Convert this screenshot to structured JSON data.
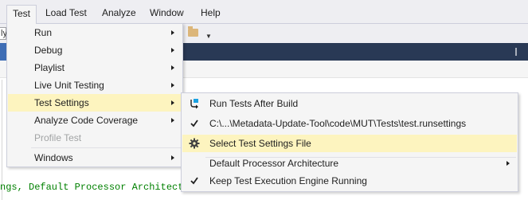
{
  "menubar": {
    "items": [
      {
        "label": "Test"
      },
      {
        "label": "Load Test"
      },
      {
        "label": "Analyze"
      },
      {
        "label": "Window"
      },
      {
        "label": "Help"
      }
    ]
  },
  "toolbar": {
    "field_text": "ly"
  },
  "code": {
    "line": "ngs, Default Processor Architect"
  },
  "test_menu": {
    "items": [
      {
        "label": "Run",
        "submenu": true
      },
      {
        "label": "Debug",
        "submenu": true
      },
      {
        "label": "Playlist",
        "submenu": true
      },
      {
        "label": "Live Unit Testing",
        "submenu": true
      },
      {
        "label": "Test Settings",
        "submenu": true,
        "highlighted": true
      },
      {
        "label": "Analyze Code Coverage",
        "submenu": true
      },
      {
        "label": "Profile Test",
        "disabled": true
      },
      {
        "label": "Windows",
        "submenu": true
      }
    ]
  },
  "test_settings_menu": {
    "items": [
      {
        "label": "Run Tests After Build",
        "icon": "run-after-build-icon"
      },
      {
        "label": "C:\\...\\Metadata-Update-Tool\\code\\MUT\\Tests\\test.runsettings",
        "icon": "checkmark-icon",
        "checked": true
      },
      {
        "label": "Select Test Settings File",
        "icon": "gear-icon",
        "highlighted": true
      },
      {
        "label": "Default Processor Architecture",
        "submenu": true
      },
      {
        "label": "Keep Test Execution Engine Running",
        "icon": "checkmark-icon",
        "checked": true
      }
    ]
  },
  "colors": {
    "menu_bg": "#f5f5f5",
    "highlight": "#fdf4bf",
    "tabstrip": "#293955",
    "code_green": "#008000"
  }
}
